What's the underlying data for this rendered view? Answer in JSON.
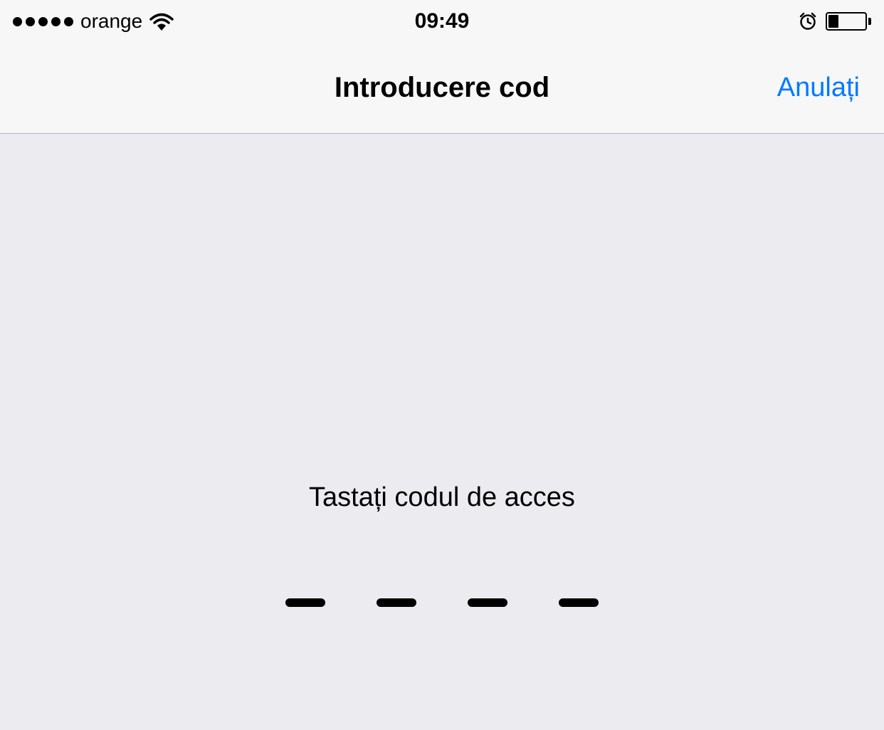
{
  "status_bar": {
    "carrier": "orange",
    "time": "09:49"
  },
  "nav": {
    "title": "Introducere cod",
    "cancel_label": "Anulați"
  },
  "content": {
    "prompt": "Tastați codul de acces"
  }
}
